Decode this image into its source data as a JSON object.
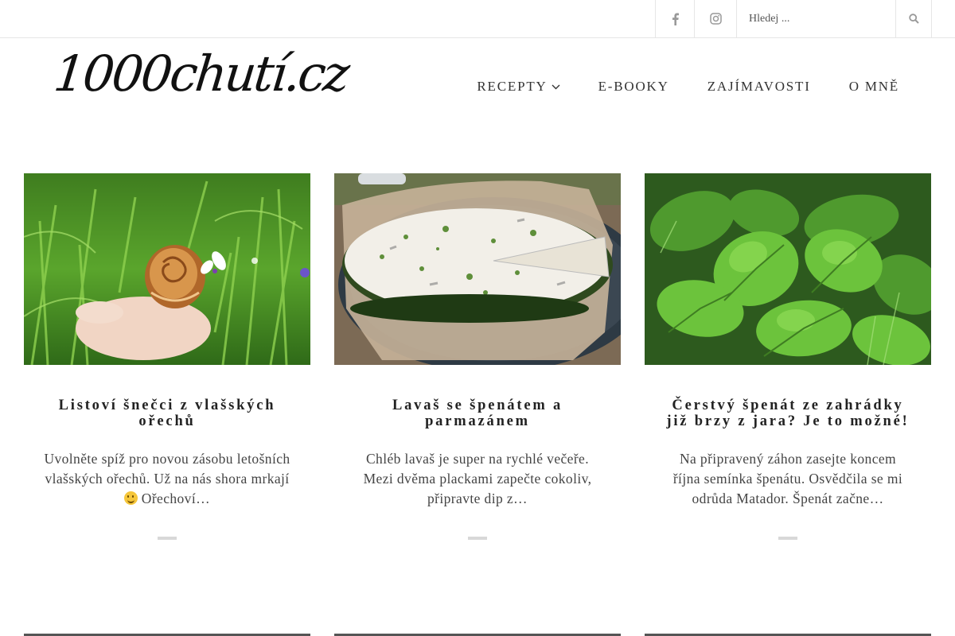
{
  "topbar": {
    "search": {
      "placeholder": "Hledej ..."
    },
    "icons": {
      "facebook": "facebook-icon",
      "instagram": "instagram-icon",
      "search": "search-icon"
    }
  },
  "header": {
    "logo_text": "1000chutí.cz",
    "nav": [
      {
        "label": "RECEPTY",
        "has_dropdown": true
      },
      {
        "label": "E-BOOKY"
      },
      {
        "label": "ZAJÍMAVOSTI"
      },
      {
        "label": "O MNĚ"
      }
    ]
  },
  "posts": [
    {
      "title": "Listoví šnečci z vlašských ořechů",
      "excerpt_before_emoji": "Uvolněte spíž pro novou zásobu letošních vlašských ořechů. Už na nás shora mrkají ",
      "excerpt_after_emoji": " Ořechoví…",
      "image": "walnut-pastry-photo"
    },
    {
      "title": "Lavaš se špenátem a parmazánem",
      "excerpt": "Chléb lavaš je super na rychlé večeře. Mezi dvěma plackami zapečte cokoliv, připravte dip z…",
      "image": "lavash-spinach-photo"
    },
    {
      "title": "Čerstvý špenát ze zahrádky již brzy z jara? Je to možné!",
      "excerpt": "Na připravený záhon zasejte koncem října semínka špenátu. Osvědčila se mi odrůda Matador. Špenát začne…",
      "image": "spinach-garden-photo"
    }
  ],
  "colors": {
    "text": "#333333",
    "border": "#e6e6e6",
    "separator": "#d8d8d8",
    "icon": "#999999"
  }
}
